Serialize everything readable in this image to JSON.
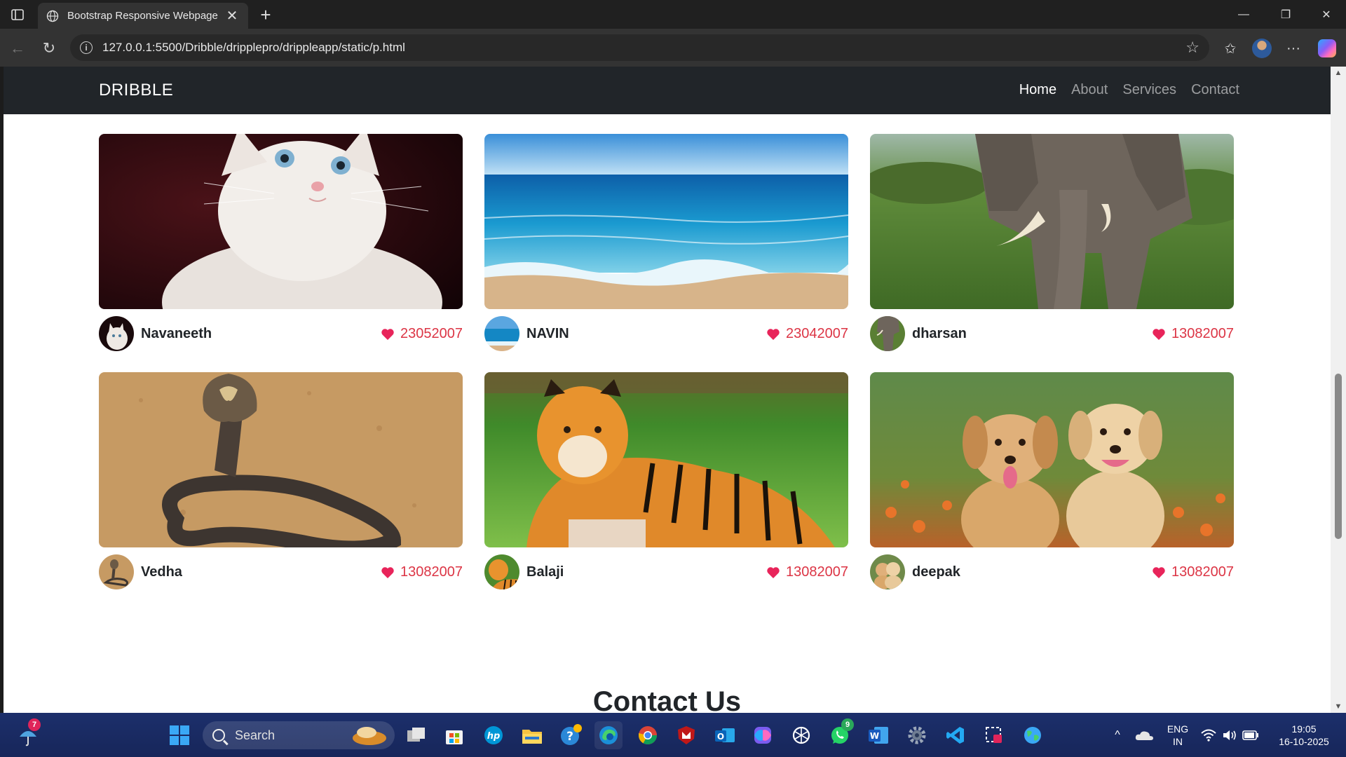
{
  "browser": {
    "tab_title": "Bootstrap Responsive Webpage",
    "url": "127.0.0.1:5500/Dribble/dripplepro/drippleapp/static/p.html"
  },
  "site": {
    "brand": "DRIBBLE",
    "nav": [
      "Home",
      "About",
      "Services",
      "Contact"
    ],
    "active_nav": "Home",
    "contact_heading": "Contact Us"
  },
  "cards": [
    {
      "name": "Navaneeth",
      "likes": "23052007",
      "image": "kitten"
    },
    {
      "name": "NAVIN",
      "likes": "23042007",
      "image": "beach"
    },
    {
      "name": "dharsan",
      "likes": "13082007",
      "image": "elephant"
    },
    {
      "name": "Vedha",
      "likes": "13082007",
      "image": "cobra"
    },
    {
      "name": "Balaji",
      "likes": "13082007",
      "image": "tiger"
    },
    {
      "name": "deepak",
      "likes": "13082007",
      "image": "puppies"
    }
  ],
  "colors": {
    "navbar": "#212529",
    "like_red": "#dc3545",
    "heart": "#e8245a"
  },
  "taskbar": {
    "search_placeholder": "Search",
    "weather_badge": "7",
    "whatsapp_badge": "9",
    "lang_line1": "ENG",
    "lang_line2": "IN",
    "time": "19:05",
    "date": "16-10-2025"
  }
}
